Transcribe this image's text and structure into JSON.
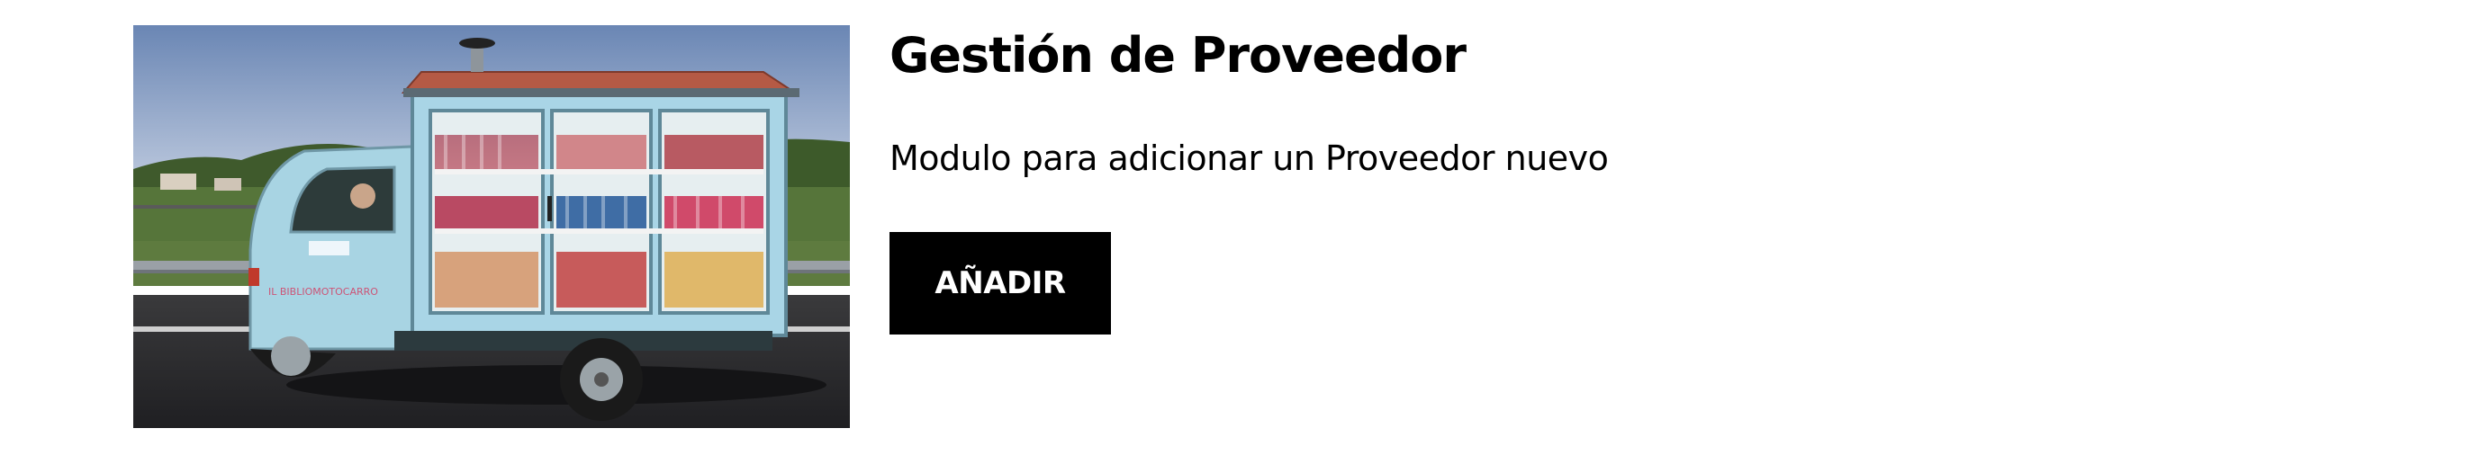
{
  "card": {
    "image_alt": "Camioneta biblioteca con estantes de libros",
    "image_text": "IL BIBLIOMOTOCARRO",
    "title": "Gestión de Proveedor",
    "description": "Modulo para adicionar un Proveedor nuevo",
    "add_button_label": "AÑADIR"
  },
  "colors": {
    "button_bg": "#000000",
    "button_text": "#ffffff",
    "text": "#000000"
  }
}
